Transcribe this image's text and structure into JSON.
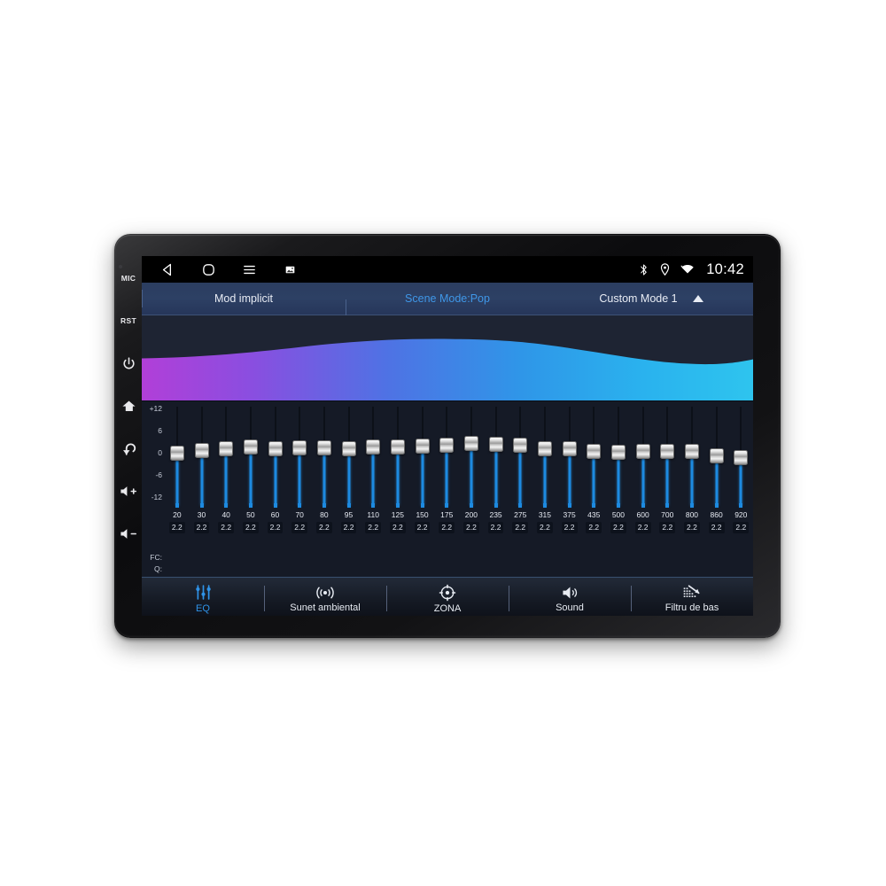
{
  "device": {
    "hardware_buttons": [
      {
        "name": "mic",
        "label": "MIC",
        "icon": "mic-label"
      },
      {
        "name": "reset",
        "label": "RST",
        "icon": "reset-label"
      },
      {
        "name": "power",
        "label": "",
        "icon": "power-icon"
      },
      {
        "name": "home",
        "label": "",
        "icon": "home-icon"
      },
      {
        "name": "back",
        "label": "",
        "icon": "back-arrow-icon"
      },
      {
        "name": "volume-up",
        "label": "",
        "icon": "volume-up-icon"
      },
      {
        "name": "volume-down",
        "label": "",
        "icon": "volume-down-icon"
      }
    ]
  },
  "statusbar": {
    "nav": [
      {
        "name": "back",
        "icon": "back-triangle-icon"
      },
      {
        "name": "home",
        "icon": "home-squircle-icon"
      },
      {
        "name": "menu",
        "icon": "hamburger-menu-icon"
      },
      {
        "name": "screenshot",
        "icon": "screenshot-icon"
      }
    ],
    "indicators": [
      {
        "name": "bluetooth",
        "icon": "bluetooth-icon"
      },
      {
        "name": "location",
        "icon": "location-pin-icon"
      },
      {
        "name": "wifi",
        "icon": "wifi-icon"
      }
    ],
    "time": "10:42"
  },
  "modebar": {
    "default_mode": "Mod implicit",
    "scene_mode": "Scene Mode:Pop",
    "custom_mode": "Custom Mode 1",
    "expand_icon": "caret-up-icon",
    "accent_color": "#3f97e8"
  },
  "waveform": {
    "name": "eq-response-curve",
    "gradient_start": "#b13fd8",
    "gradient_mid": "#3f7ae0",
    "gradient_end": "#2ec4ee",
    "background": "#1e2433"
  },
  "equalizer": {
    "scale_labels": [
      "+12",
      "6",
      "0",
      "-6",
      "-12"
    ],
    "scale_values": [
      12,
      6,
      0,
      -6,
      -12
    ],
    "row_label_fc": "FC:",
    "row_label_q": "Q:",
    "track_color": "#1d8ae0",
    "bands": [
      {
        "fc": "20",
        "q": "2.2",
        "gain": 0.0
      },
      {
        "fc": "30",
        "q": "2.2",
        "gain": 0.7
      },
      {
        "fc": "40",
        "q": "2.2",
        "gain": 1.2
      },
      {
        "fc": "50",
        "q": "2.2",
        "gain": 1.6
      },
      {
        "fc": "60",
        "q": "2.2",
        "gain": 1.3
      },
      {
        "fc": "70",
        "q": "2.2",
        "gain": 1.5
      },
      {
        "fc": "80",
        "q": "2.2",
        "gain": 1.4
      },
      {
        "fc": "95",
        "q": "2.2",
        "gain": 1.3
      },
      {
        "fc": "110",
        "q": "2.2",
        "gain": 1.6
      },
      {
        "fc": "125",
        "q": "2.2",
        "gain": 1.7
      },
      {
        "fc": "150",
        "q": "2.2",
        "gain": 2.0
      },
      {
        "fc": "175",
        "q": "2.2",
        "gain": 2.1
      },
      {
        "fc": "200",
        "q": "2.2",
        "gain": 2.6
      },
      {
        "fc": "235",
        "q": "2.2",
        "gain": 2.4
      },
      {
        "fc": "275",
        "q": "2.2",
        "gain": 2.1
      },
      {
        "fc": "315",
        "q": "2.2",
        "gain": 1.3
      },
      {
        "fc": "375",
        "q": "2.2",
        "gain": 1.2
      },
      {
        "fc": "435",
        "q": "2.2",
        "gain": 0.5
      },
      {
        "fc": "500",
        "q": "2.2",
        "gain": 0.3
      },
      {
        "fc": "600",
        "q": "2.2",
        "gain": 0.4
      },
      {
        "fc": "700",
        "q": "2.2",
        "gain": 0.6
      },
      {
        "fc": "800",
        "q": "2.2",
        "gain": 0.5
      },
      {
        "fc": "860",
        "q": "2.2",
        "gain": -0.6
      },
      {
        "fc": "920",
        "q": "2.2",
        "gain": -1.2
      }
    ]
  },
  "tabs": [
    {
      "label": "EQ",
      "icon": "equalizer-sliders-icon",
      "active": true
    },
    {
      "label": "Sunet ambiental",
      "icon": "surround-sound-icon",
      "active": false
    },
    {
      "label": "ZONA",
      "icon": "zone-target-icon",
      "active": false
    },
    {
      "label": "Sound",
      "icon": "speaker-icon",
      "active": false
    },
    {
      "label": "Filtru de bas",
      "icon": "bass-filter-icon",
      "active": false
    }
  ]
}
